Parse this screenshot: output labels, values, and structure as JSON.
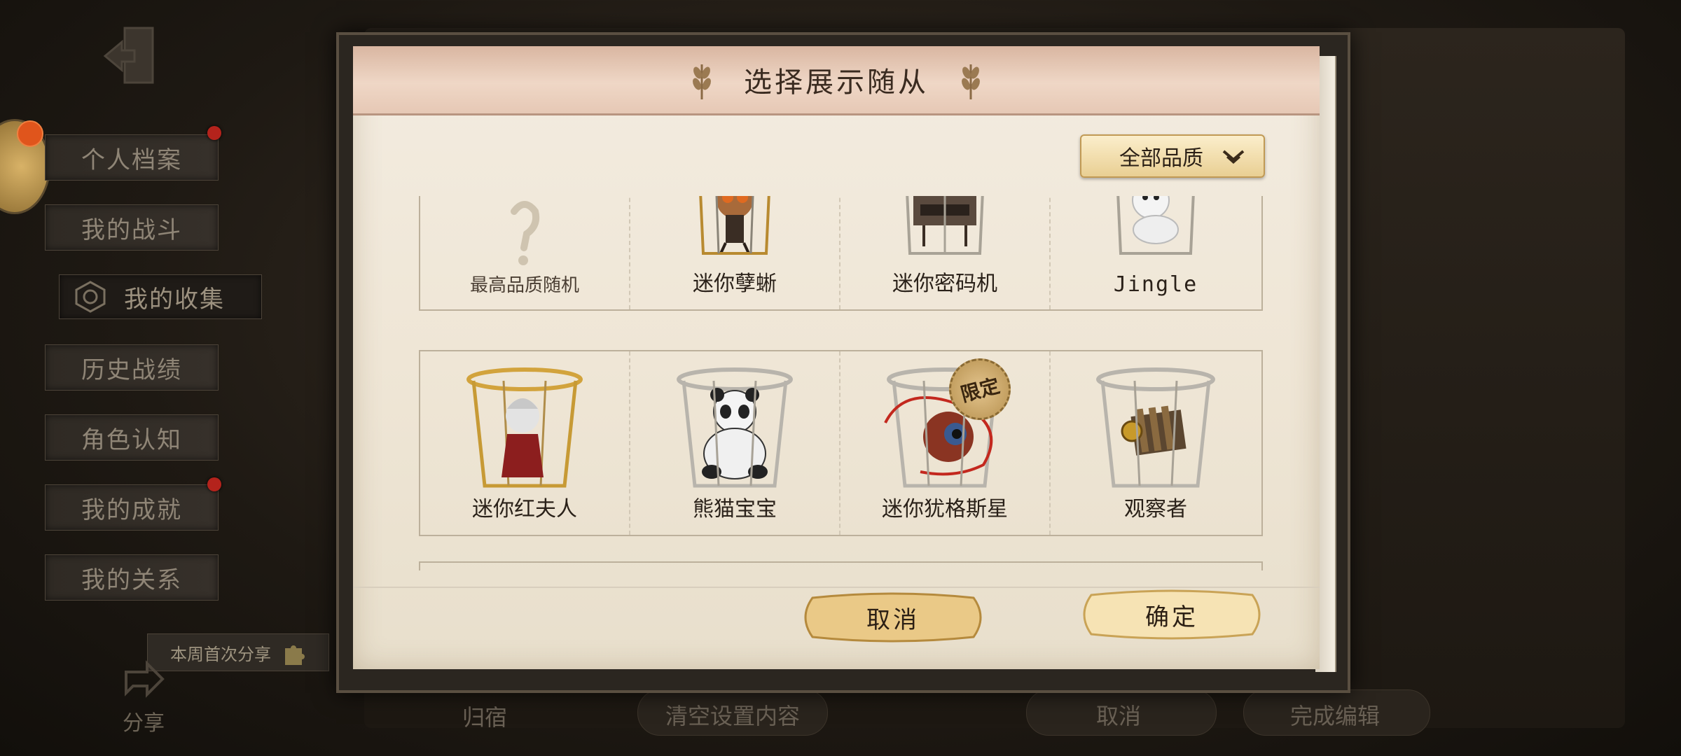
{
  "sidebar": {
    "items": [
      {
        "label": "个人档案",
        "has_dot": true
      },
      {
        "label": "我的战斗",
        "has_dot": false
      },
      {
        "label": "我的收集",
        "has_dot": false,
        "active": true
      },
      {
        "label": "历史战绩",
        "has_dot": false
      },
      {
        "label": "角色认知",
        "has_dot": false
      },
      {
        "label": "我的成就",
        "has_dot": true
      },
      {
        "label": "我的关系",
        "has_dot": false
      }
    ],
    "share_banner": "本周首次分享",
    "share_label": "分享"
  },
  "background_bar": {
    "left_label": "归宿",
    "clear_label": "清空设置内容",
    "cancel_label": "取消",
    "finish_label": "完成编辑"
  },
  "dialog": {
    "title": "选择展示随从",
    "filter": {
      "selected": "全部品质"
    },
    "row1": [
      {
        "label": "最高品质随机",
        "icon": "question-mark-icon"
      },
      {
        "label": "迷你孽蜥",
        "icon": "mini-lizard-pet-icon"
      },
      {
        "label": "迷你密码机",
        "icon": "mini-cipher-machine-pet-icon"
      },
      {
        "label": "Jingle",
        "icon": "jingle-dog-pet-icon"
      }
    ],
    "row2": [
      {
        "label": "迷你红夫人",
        "icon": "mini-red-lady-pet-icon"
      },
      {
        "label": "熊猫宝宝",
        "icon": "panda-baby-pet-icon"
      },
      {
        "label": "迷你犹格斯星",
        "icon": "mini-yuggoth-pet-icon"
      },
      {
        "label": "观察者",
        "icon": "observer-pet-icon"
      }
    ],
    "limited_badge": "限定",
    "cancel_label": "取消",
    "confirm_label": "确定"
  },
  "colors": {
    "header": "#e9ccb9",
    "paper": "#f1e9db",
    "button_gold": "#f0d79f"
  }
}
